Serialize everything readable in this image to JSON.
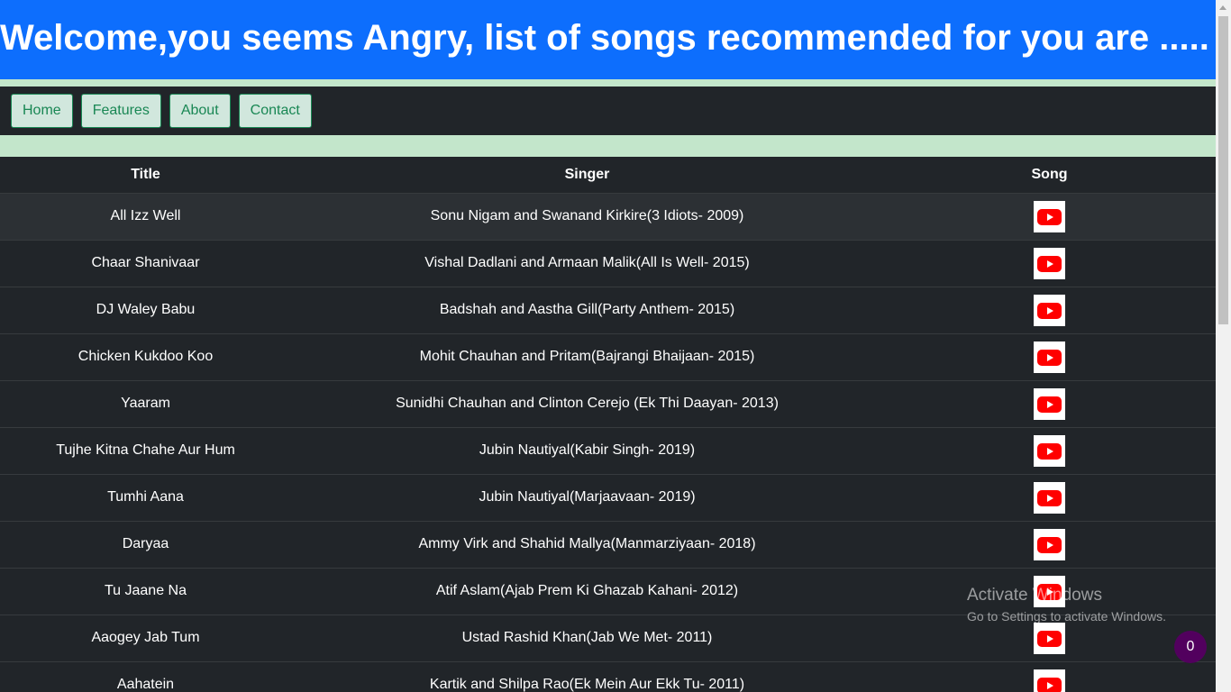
{
  "header": {
    "title": "Welcome,you seems Angry, list of songs recommended for you are ....."
  },
  "nav": {
    "items": [
      "Home",
      "Features",
      "About",
      "Contact"
    ]
  },
  "table": {
    "headers": {
      "title": "Title",
      "singer": "Singer",
      "song": "Song"
    },
    "rows": [
      {
        "title": "All Izz Well",
        "singer": "Sonu Nigam and Swanand Kirkire(3 Idiots- 2009)",
        "icon": "youtube-icon"
      },
      {
        "title": "Chaar Shanivaar",
        "singer": "Vishal Dadlani and Armaan Malik(All Is Well- 2015)",
        "icon": "youtube-icon"
      },
      {
        "title": "DJ Waley Babu",
        "singer": "Badshah and Aastha Gill(Party Anthem- 2015)",
        "icon": "youtube-icon"
      },
      {
        "title": "Chicken Kukdoo Koo",
        "singer": "Mohit Chauhan and Pritam(Bajrangi Bhaijaan- 2015)",
        "icon": "youtube-icon"
      },
      {
        "title": "Yaaram",
        "singer": "Sunidhi Chauhan and Clinton Cerejo (Ek Thi Daayan- 2013)",
        "icon": "youtube-icon"
      },
      {
        "title": "Tujhe Kitna Chahe Aur Hum",
        "singer": "Jubin Nautiyal(Kabir Singh- 2019)",
        "icon": "youtube-icon"
      },
      {
        "title": "Tumhi Aana",
        "singer": "Jubin Nautiyal(Marjaavaan- 2019)",
        "icon": "youtube-icon"
      },
      {
        "title": "Daryaa",
        "singer": "Ammy Virk and Shahid Mallya(Manmarziyaan- 2018)",
        "icon": "youtube-icon"
      },
      {
        "title": "Tu Jaane Na",
        "singer": "Atif Aslam(Ajab Prem Ki Ghazab Kahani- 2012)",
        "icon": "youtube-icon"
      },
      {
        "title": "Aaogey Jab Tum",
        "singer": "Ustad Rashid Khan(Jab We Met- 2011)",
        "icon": "youtube-icon"
      },
      {
        "title": "Aahatein",
        "singer": "Kartik and Shilpa Rao(Ek Mein Aur Ekk Tu- 2011)",
        "icon": "youtube-icon"
      }
    ]
  },
  "watermark": {
    "line1": "Activate Windows",
    "line2": "Go to Settings to activate Windows."
  },
  "badge": {
    "count": "0"
  },
  "colors": {
    "banner": "#0d6efd",
    "stripe": "#c3e6cb",
    "table_bg": "#212529",
    "nav_button_bg": "#d1e7dd",
    "nav_button_text": "#198754",
    "youtube_red": "#ff0000",
    "badge_bg": "#52005e"
  }
}
